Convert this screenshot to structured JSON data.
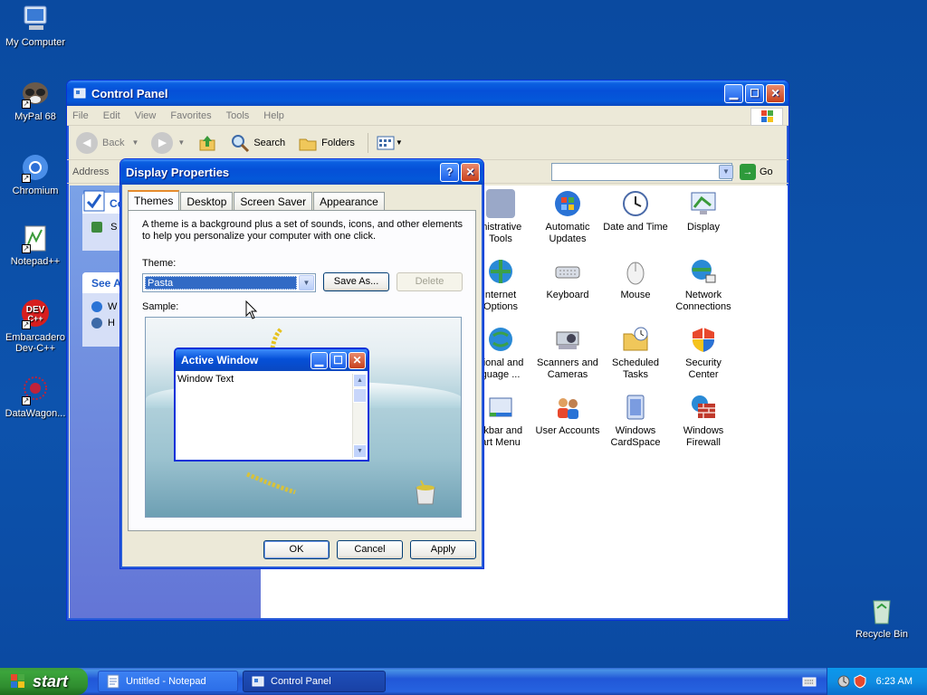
{
  "desktop": {
    "icons": [
      {
        "label": "My Computer"
      },
      {
        "label": "MyPal 68"
      },
      {
        "label": "Chromium"
      },
      {
        "label": "Notepad++"
      },
      {
        "label": "Embarcadero Dev-C++"
      },
      {
        "label": "DataWagon..."
      },
      {
        "label": "Recycle Bin"
      }
    ]
  },
  "control_panel": {
    "title": "Control Panel",
    "menu": [
      "File",
      "Edit",
      "View",
      "Favorites",
      "Tools",
      "Help"
    ],
    "toolbar": {
      "back": "Back",
      "search": "Search",
      "folders": "Folders"
    },
    "address_label": "Address",
    "go_label": "Go",
    "left_pane": {
      "box1_title": "Co",
      "box1_item": "S",
      "box2_title": "See A",
      "box2_items": [
        "W",
        "H"
      ]
    },
    "items": [
      {
        "label": "Administrative Tools",
        "shown": "inistrative\nTools"
      },
      {
        "label": "Automatic Updates",
        "shown": "Automatic\nUpdates"
      },
      {
        "label": "Date and Time",
        "shown": "Date and Time"
      },
      {
        "label": "Display",
        "shown": "Display"
      },
      {
        "label": "Internet Options",
        "shown": "nternet\nOptions"
      },
      {
        "label": "Keyboard",
        "shown": "Keyboard"
      },
      {
        "label": "Mouse",
        "shown": "Mouse"
      },
      {
        "label": "Network Connections",
        "shown": "Network\nConnections"
      },
      {
        "label": "Regional and Language ...",
        "shown": "gional and\nguage ..."
      },
      {
        "label": "Scanners and Cameras",
        "shown": "Scanners and\nCameras"
      },
      {
        "label": "Scheduled Tasks",
        "shown": "Scheduled\nTasks"
      },
      {
        "label": "Security Center",
        "shown": "Security\nCenter"
      },
      {
        "label": "Taskbar and Start Menu",
        "shown": "skbar and\nart Menu"
      },
      {
        "label": "User Accounts",
        "shown": "User Accounts"
      },
      {
        "label": "Windows CardSpace",
        "shown": "Windows\nCardSpace"
      },
      {
        "label": "Windows Firewall",
        "shown": "Windows\nFirewall"
      }
    ]
  },
  "display_properties": {
    "title": "Display Properties",
    "tabs": [
      "Themes",
      "Desktop",
      "Screen Saver",
      "Appearance"
    ],
    "description": "A theme is a background plus a set of sounds, icons, and other elements to help you personalize your computer with one click.",
    "theme_label": "Theme:",
    "theme_value": "Pasta",
    "save_as": "Save As...",
    "delete": "Delete",
    "sample_label": "Sample:",
    "active_window_title": "Active Window",
    "window_text": "Window Text",
    "ok": "OK",
    "cancel": "Cancel",
    "apply": "Apply"
  },
  "taskbar": {
    "start": "start",
    "tasks": [
      "Untitled - Notepad",
      "Control Panel"
    ],
    "clock": "6:23 AM"
  },
  "colors": {
    "desktop": "#0b4aa0",
    "titlebar": "#0550d8",
    "selection": "#316ac5",
    "start_button": "#3ca53c"
  }
}
